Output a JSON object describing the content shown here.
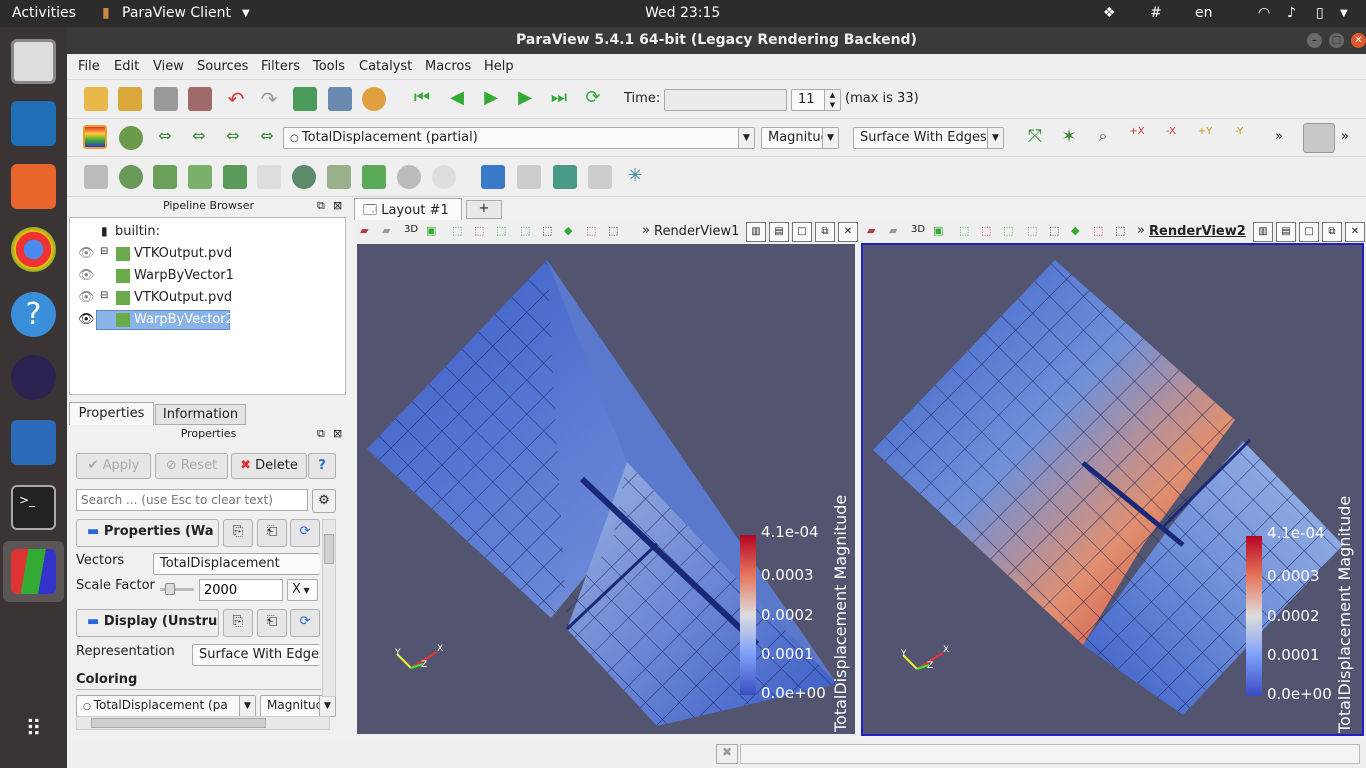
{
  "topbar": {
    "activities": "Activities",
    "app_menu": "ParaView Client",
    "clock": "Wed 23:15",
    "lang": "en"
  },
  "window": {
    "title": "ParaView 5.4.1 64-bit (Legacy Rendering Backend)"
  },
  "menu": [
    "File",
    "Edit",
    "View",
    "Sources",
    "Filters",
    "Tools",
    "Catalyst",
    "Macros",
    "Help"
  ],
  "time": {
    "label": "Time:",
    "value": "",
    "step": "11",
    "max_label": "(max is 33)"
  },
  "coloring_toolbar": {
    "array": "TotalDisplacement (partial)",
    "component": "Magnituc",
    "representation": "Surface With Edges"
  },
  "pipeline": {
    "title": "Pipeline Browser",
    "items": [
      {
        "label": "builtin:"
      },
      {
        "label": "VTKOutput.pvd"
      },
      {
        "label": "WarpByVector1"
      },
      {
        "label": "VTKOutput.pvd"
      },
      {
        "label": "WarpByVector2",
        "selected": true
      }
    ]
  },
  "tabs": {
    "properties": "Properties",
    "information": "Information"
  },
  "properties": {
    "title": "Properties",
    "apply": "Apply",
    "reset": "Reset",
    "delete": "Delete",
    "help": "?",
    "search_placeholder": "Search ... (use Esc to clear text)",
    "section_props": "Properties (Wa",
    "vectors_label": "Vectors",
    "vectors_value": "TotalDisplacement",
    "scale_label": "Scale Factor",
    "scale_value": "2000",
    "scale_axis": "X",
    "section_display": "Display (Unstru",
    "repr_label": "Representation",
    "repr_value": "Surface With Edges",
    "coloring_label": "Coloring",
    "coloring_array": "TotalDisplacement (pa",
    "coloring_comp": "Magnitud"
  },
  "layout": {
    "tab": "Layout #1",
    "add": "+"
  },
  "views": [
    {
      "name": "RenderView1",
      "colorbar_title": "TotalDisplacement Magnitude",
      "ticks": [
        "4.1e-04",
        "0.0003",
        "0.0002",
        "0.0001",
        "0.0e+00"
      ]
    },
    {
      "name": "RenderView2",
      "colorbar_title": "TotalDisplacement Magnitude",
      "ticks": [
        "4.1e-04",
        "0.0003",
        "0.0002",
        "0.0001",
        "0.0e+00"
      ]
    }
  ],
  "axes": {
    "x": "X",
    "y": "Y",
    "z": "Z"
  },
  "colors": {
    "view_bg": "#525470",
    "select_blue": "#8ab4e8",
    "active_border": "#1f1fc8"
  }
}
